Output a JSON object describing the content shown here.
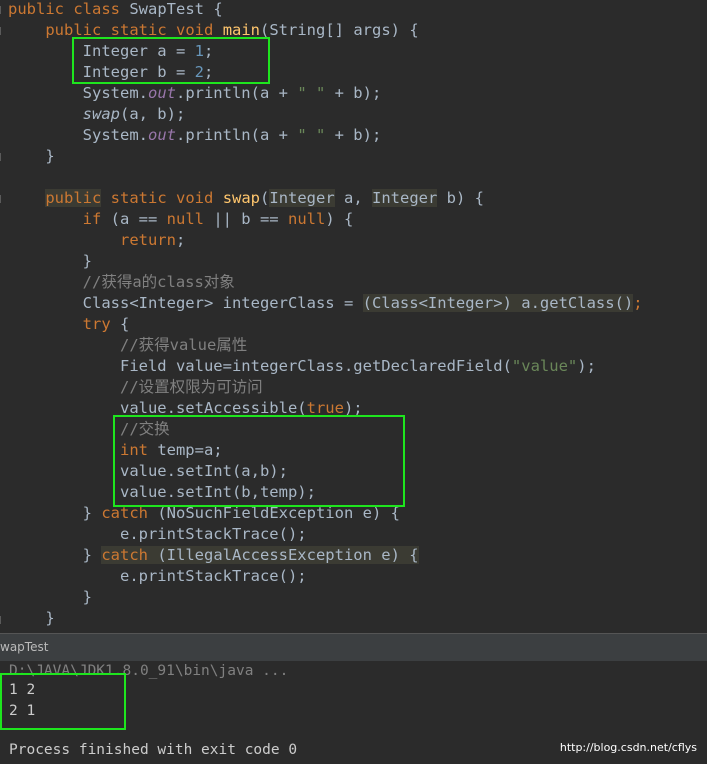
{
  "code": {
    "l01": [
      "public",
      " ",
      "class",
      " SwapTest {"
    ],
    "l02": [
      "    ",
      "public",
      " ",
      "static",
      " ",
      "void",
      " ",
      "main",
      "(String[] args) {"
    ],
    "l03": [
      "        Integer a = ",
      "1",
      ";"
    ],
    "l04": [
      "        Integer b = ",
      "2",
      ";"
    ],
    "l05": [
      "        System.",
      "out",
      ".println(a + ",
      "\" \"",
      " + b);"
    ],
    "l06": [
      "        ",
      "swap",
      "(a, b);"
    ],
    "l07": [
      "        System.",
      "out",
      ".println(a + ",
      "\" \"",
      " + b);"
    ],
    "l08": [
      "    }"
    ],
    "l09": [
      "    ",
      "public",
      " ",
      "static",
      " ",
      "void",
      " ",
      "swap",
      "(",
      "Integer",
      " a, ",
      "Integer",
      " b) {"
    ],
    "l10": [
      "        ",
      "if",
      " (a == ",
      "null",
      " || b == ",
      "null",
      ") {"
    ],
    "l11": [
      "            ",
      "return",
      ";"
    ],
    "l12": [
      "        }"
    ],
    "l13": [
      "        //获得a的class对象"
    ],
    "l14": [
      "        Class<Integer> integerClass = ",
      "(Class<Integer>)",
      " a.getClass()",
      ";"
    ],
    "l15": [
      "        ",
      "try",
      " {"
    ],
    "l16": [
      "            //获得value属性"
    ],
    "l17": [
      "            Field value=integerClass.getDeclaredField(",
      "\"value\"",
      ");"
    ],
    "l18": [
      "            //设置权限为可访问"
    ],
    "l19": [
      "            value.setAccessible(",
      "true",
      ");"
    ],
    "l20": [
      "            //交换"
    ],
    "l21": [
      "            ",
      "int",
      " temp=a;"
    ],
    "l22": [
      "            value.setInt(a,b);"
    ],
    "l23": [
      "            value.setInt(b,temp);"
    ],
    "l24": [
      "        } ",
      "catch",
      " (NoSuchFieldException e) {"
    ],
    "l25": [
      "            e.printStackTrace();"
    ],
    "l26": [
      "        } ",
      "catch",
      " (IllegalAccessException e) {"
    ],
    "l27": [
      "            e.printStackTrace();"
    ],
    "l28": [
      "        }"
    ],
    "l29": [
      "    }"
    ]
  },
  "run_panel": {
    "title": "wapTest"
  },
  "console": {
    "command": "D:\\JAVA\\JDK1.8.0_91\\bin\\java ...",
    "output_line_1": "1 2",
    "output_line_2": "2 1",
    "exit_message": "Process finished with exit code 0"
  },
  "watermark": "http://blog.csdn.net/cflys",
  "colors": {
    "highlight_box": "#1ee51e",
    "keyword": "#cc7832",
    "function": "#ffc66d",
    "number": "#6897bb",
    "string": "#6a8759",
    "comment": "#808080"
  }
}
